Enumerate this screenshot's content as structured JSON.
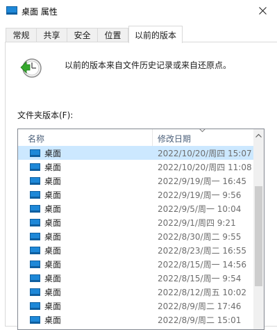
{
  "window": {
    "title": "桌面 属性",
    "title_icon": "desktop-folder-icon",
    "close_icon": "close-icon"
  },
  "tabs": [
    {
      "label": "常规",
      "active": false
    },
    {
      "label": "共享",
      "active": false
    },
    {
      "label": "安全",
      "active": false
    },
    {
      "label": "位置",
      "active": false
    },
    {
      "label": "以前的版本",
      "active": true
    }
  ],
  "description": "以前的版本来自文件历史记录或来自还原点。",
  "section_label": "文件夹版本(F):",
  "list": {
    "columns": {
      "name": "名称",
      "date": "修改日期"
    },
    "rows": [
      {
        "name": "桌面",
        "date": "2022/10/20/周四 15:07",
        "selected": true
      },
      {
        "name": "桌面",
        "date": "2022/10/20/周四 11:08",
        "selected": false
      },
      {
        "name": "桌面",
        "date": "2022/9/19/周一 16:45",
        "selected": false
      },
      {
        "name": "桌面",
        "date": "2022/9/19/周一 9:56",
        "selected": false
      },
      {
        "name": "桌面",
        "date": "2022/9/5/周一 10:04",
        "selected": false
      },
      {
        "name": "桌面",
        "date": "2022/9/1/周四 9:21",
        "selected": false
      },
      {
        "name": "桌面",
        "date": "2022/8/30/周二 9:55",
        "selected": false
      },
      {
        "name": "桌面",
        "date": "2022/8/23/周二 16:55",
        "selected": false
      },
      {
        "name": "桌面",
        "date": "2022/8/15/周一 14:56",
        "selected": false
      },
      {
        "name": "桌面",
        "date": "2022/8/15/周一 9:54",
        "selected": false
      },
      {
        "name": "桌面",
        "date": "2022/8/12/周五 10:02",
        "selected": false
      },
      {
        "name": "桌面",
        "date": "2022/8/9/周二 17:46",
        "selected": false
      },
      {
        "name": "桌面",
        "date": "2022/8/9/周二 15:01",
        "selected": false
      }
    ]
  },
  "colors": {
    "selection": "#cce8ff",
    "folder_blue": "#1e88d8",
    "tab_border": "#d9d9d9"
  }
}
